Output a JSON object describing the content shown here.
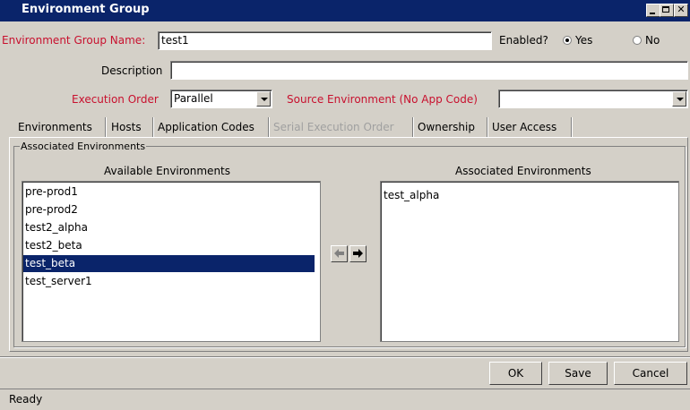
{
  "window": {
    "title": "Environment Group"
  },
  "form": {
    "group_name_label": "Environment Group Name:",
    "group_name_value": "test1",
    "enabled_label": "Enabled?",
    "enabled_yes": "Yes",
    "enabled_no": "No",
    "enabled_value": "Yes",
    "description_label": "Description",
    "description_value": "",
    "execution_order_label": "Execution Order",
    "execution_order_value": "Parallel",
    "source_env_label": "Source Environment (No App Code)",
    "source_env_value": ""
  },
  "tabs": [
    {
      "label": "Environments",
      "active": true
    },
    {
      "label": "Hosts"
    },
    {
      "label": "Application Codes"
    },
    {
      "label": "Serial Execution Order",
      "disabled": true
    },
    {
      "label": "Ownership"
    },
    {
      "label": "User Access"
    }
  ],
  "panel": {
    "group_title": "Associated Environments",
    "available_header": "Available Environments",
    "associated_header": "Associated Environments",
    "available": [
      "pre-prod1",
      "pre-prod2",
      "test2_alpha",
      "test2_beta",
      "test_beta",
      "test_server1"
    ],
    "available_selected": "test_beta",
    "associated": [
      "test_alpha"
    ]
  },
  "buttons": {
    "ok": "OK",
    "save": "Save",
    "cancel": "Cancel"
  },
  "status": {
    "text": "Ready"
  },
  "icons": {
    "left": "arrow-left-icon",
    "right": "arrow-right-icon"
  }
}
